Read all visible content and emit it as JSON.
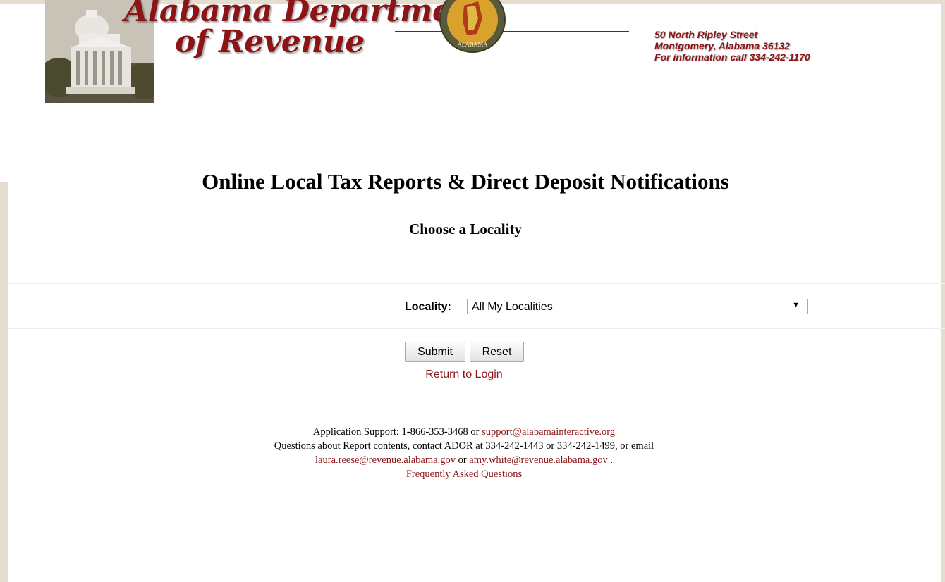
{
  "header": {
    "logo_line1": "Alabama Department",
    "logo_line2": "of Revenue",
    "seal_text": "ALABAMA",
    "address_line1": "50 North Ripley Street",
    "address_line2": "Montgomery, Alabama 36132",
    "address_line3": "For information call 334-242-1170"
  },
  "page": {
    "title": "Online Local Tax Reports & Direct Deposit Notifications",
    "subtitle": "Choose a Locality"
  },
  "form": {
    "locality_label": "Locality:",
    "locality_value": "All My Localities",
    "submit_label": "Submit",
    "reset_label": "Reset",
    "return_link": "Return to Login"
  },
  "footer": {
    "support_prefix": "Application Support: 1-866-353-3468 or",
    "support_email": "support@alabamainteractive.org",
    "questions_text": "Questions about Report contents, contact ADOR at 334-242-1443 or 334-242-1499, or email",
    "email_1": "laura.reese@revenue.alabama.gov",
    "or_text": "or",
    "email_2": "amy.white@revenue.alabama.gov",
    "period": ".",
    "faq_link": "Frequently Asked Questions"
  },
  "colors": {
    "brand_red": "#8b1416",
    "frame_beige": "#e4ddd0"
  },
  "icons": {
    "select_arrow": "chevron-down-icon"
  }
}
